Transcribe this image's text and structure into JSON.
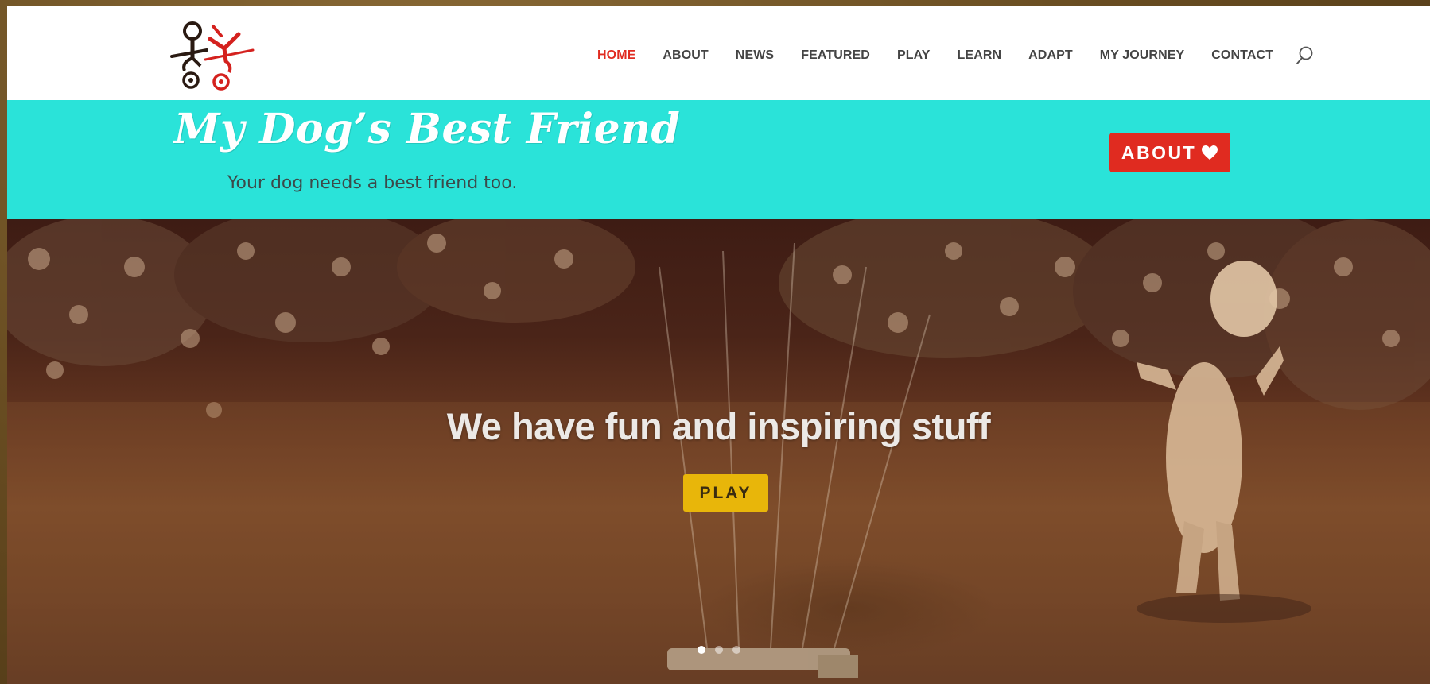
{
  "header": {
    "logo_name": "stick-figure-dog-logo",
    "nav": [
      {
        "label": "HOME",
        "active": true
      },
      {
        "label": "ABOUT",
        "active": false
      },
      {
        "label": "NEWS",
        "active": false
      },
      {
        "label": "FEATURED",
        "active": false
      },
      {
        "label": "PLAY",
        "active": false
      },
      {
        "label": "LEARN",
        "active": false
      },
      {
        "label": "ADAPT",
        "active": false
      },
      {
        "label": "MY JOURNEY",
        "active": false
      },
      {
        "label": "CONTACT",
        "active": false
      }
    ],
    "search_icon": "search-icon"
  },
  "band": {
    "title": "My Dog’s Best Friend",
    "tagline": "Your dog needs a best friend too.",
    "cta_label": "ABOUT",
    "cta_icon": "heart-icon"
  },
  "hero": {
    "title": "We have fun and inspiring stuff",
    "button_label": "PLAY",
    "slides_count": 3,
    "active_slide": 1
  },
  "colors": {
    "accent_red": "#e02b20",
    "band_teal": "#2ae3d9",
    "play_yellow": "#e8b60a",
    "nav_text": "#444444"
  }
}
